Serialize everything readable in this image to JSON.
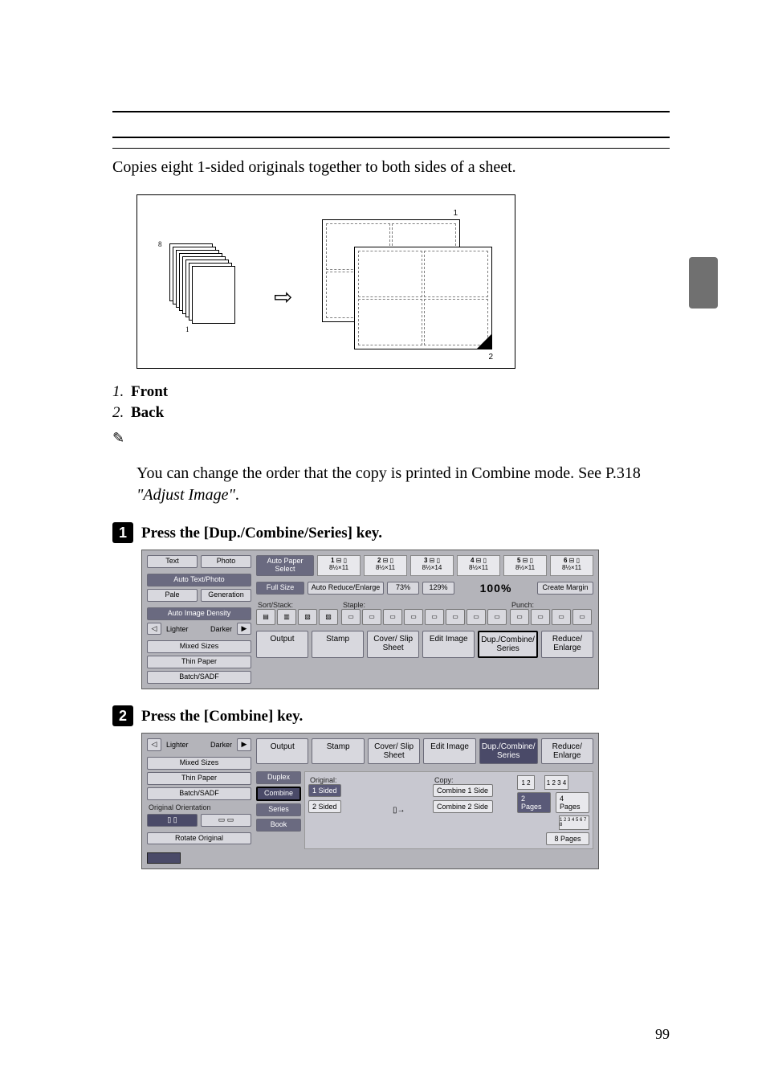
{
  "intro": "Copies eight 1-sided originals together to both sides of a sheet.",
  "diagram": {
    "stack_labels": [
      "1",
      "8"
    ],
    "callout_front": "1",
    "callout_back": "2"
  },
  "legend": [
    {
      "num": "1.",
      "label": "Front"
    },
    {
      "num": "2.",
      "label": "Back"
    }
  ],
  "note": {
    "text_prefix": "You can change the order that the copy is printed in Combine mode. See P.318 ",
    "quoted": "\"Adjust Image\"",
    "suffix": "."
  },
  "steps": [
    {
      "num": "1",
      "text_prefix": "Press the ",
      "key": "[Dup./Combine/Series]",
      "text_suffix": " key."
    },
    {
      "num": "2",
      "text_prefix": "Press the ",
      "key": "[Combine]",
      "text_suffix": " key."
    }
  ],
  "ss1": {
    "left_tabs": [
      "Text",
      "Photo"
    ],
    "left_main": "Auto Text/Photo",
    "left_row2": [
      "Pale",
      "Generation"
    ],
    "left_density": "Auto Image Density",
    "lighter": "Lighter",
    "darker": "Darker",
    "left_opts": [
      "Mixed Sizes",
      "Thin Paper",
      "Batch/SADF"
    ],
    "paper_select": "Auto Paper Select",
    "trays": [
      {
        "n": "1",
        "s": "8½×11"
      },
      {
        "n": "2",
        "s": "8½×11"
      },
      {
        "n": "3",
        "s": "8½×14"
      },
      {
        "n": "4",
        "s": "8½×11"
      },
      {
        "n": "5",
        "s": "8½×11"
      },
      {
        "n": "6",
        "s": "8½×11"
      }
    ],
    "full_size": "Full Size",
    "auto_re": "Auto Reduce/Enlarge",
    "pct1": "73%",
    "pct2": "129%",
    "pct_big": "100%",
    "create_margin": "Create Margin",
    "sort_label": "Sort/Stack:",
    "staple_label": "Staple:",
    "punch_label": "Punch:",
    "toolbar": [
      "Output",
      "Stamp",
      "Cover/ Slip Sheet",
      "Edit Image",
      "Dup./Combine/ Series",
      "Reduce/ Enlarge"
    ]
  },
  "ss2": {
    "lighter": "Lighter",
    "darker": "Darker",
    "left_opts": [
      "Mixed Sizes",
      "Thin Paper",
      "Batch/SADF"
    ],
    "orient_label": "Original Orientation",
    "rotate": "Rotate Original",
    "toolbar": [
      "Output",
      "Stamp",
      "Cover/ Slip Sheet",
      "Edit Image",
      "Dup./Combine/ Series",
      "Reduce/ Enlarge"
    ],
    "col_tabs": [
      "Duplex",
      "Combine",
      "Series",
      "Book"
    ],
    "orig_label": "Original:",
    "orig_opts": [
      "1 Sided",
      "2 Sided"
    ],
    "copy_label": "Copy:",
    "copy_opts": [
      "Combine 1 Side",
      "Combine 2 Side"
    ],
    "pages": [
      "2 Pages",
      "4 Pages",
      "8 Pages"
    ],
    "mini12": "1 2",
    "mini1234": "1 2 3 4",
    "mini8": "1 2 3 4 5 6 7 8"
  },
  "page_number": "99"
}
